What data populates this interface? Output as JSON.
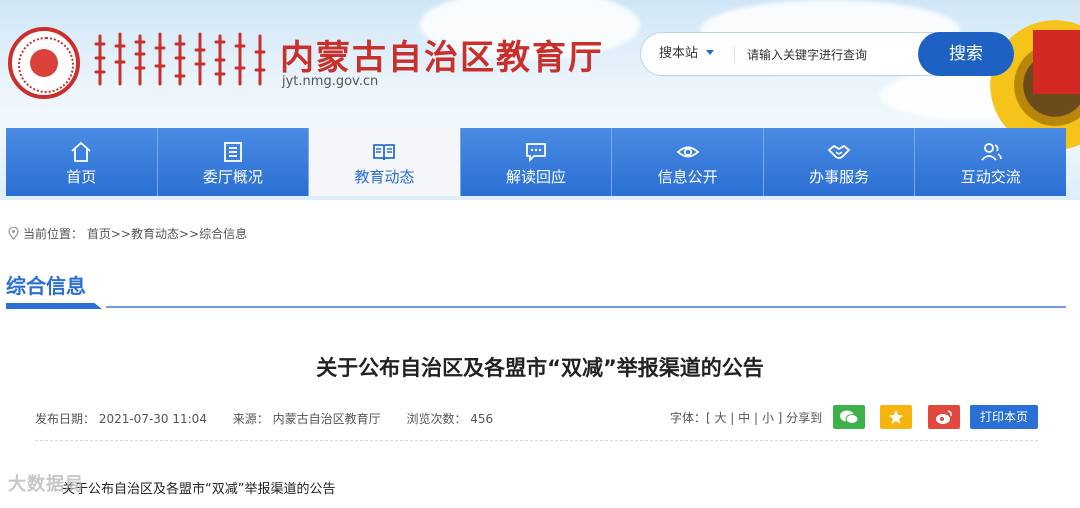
{
  "site": {
    "title": "内蒙古自治区教育厅",
    "domain": "jyt.nmg.gov.cn"
  },
  "search": {
    "scope_label": "搜本站",
    "placeholder": "请输入关键字进行查询",
    "button_label": "搜索"
  },
  "nav": {
    "items": [
      {
        "label": "首页",
        "icon": "home-icon"
      },
      {
        "label": "委厅概况",
        "icon": "document-list-icon"
      },
      {
        "label": "教育动态",
        "icon": "open-book-icon",
        "active": true
      },
      {
        "label": "解读回应",
        "icon": "chat-bubble-icon"
      },
      {
        "label": "信息公开",
        "icon": "eye-icon"
      },
      {
        "label": "办事服务",
        "icon": "handshake-icon"
      },
      {
        "label": "互动交流",
        "icon": "users-icon"
      }
    ]
  },
  "breadcrumb": {
    "prefix": "当前位置：",
    "path": "首页>>教育动态>>综合信息"
  },
  "section": {
    "title": "综合信息"
  },
  "article": {
    "title": "关于公布自治区及各盟市“双减”举报渠道的公告",
    "publish_date": "发布日期： 2021-07-30 11:04",
    "source": "来源： 内蒙古自治区教育厅",
    "views": "浏览次数： 456",
    "font_control": "字体：[ 大 | 中 | 小 ] 分享到",
    "print_label": "打印本页",
    "body_first_line": "关于公布自治区及各盟市“双减”举报渠道的公告"
  },
  "watermark": {
    "text": "大数据局"
  },
  "colors": {
    "primary": "#2a6fd3",
    "title_red": "#c9302c",
    "wechat": "#3db14a",
    "qzone": "#f5b50e",
    "weibo": "#e1493f"
  }
}
